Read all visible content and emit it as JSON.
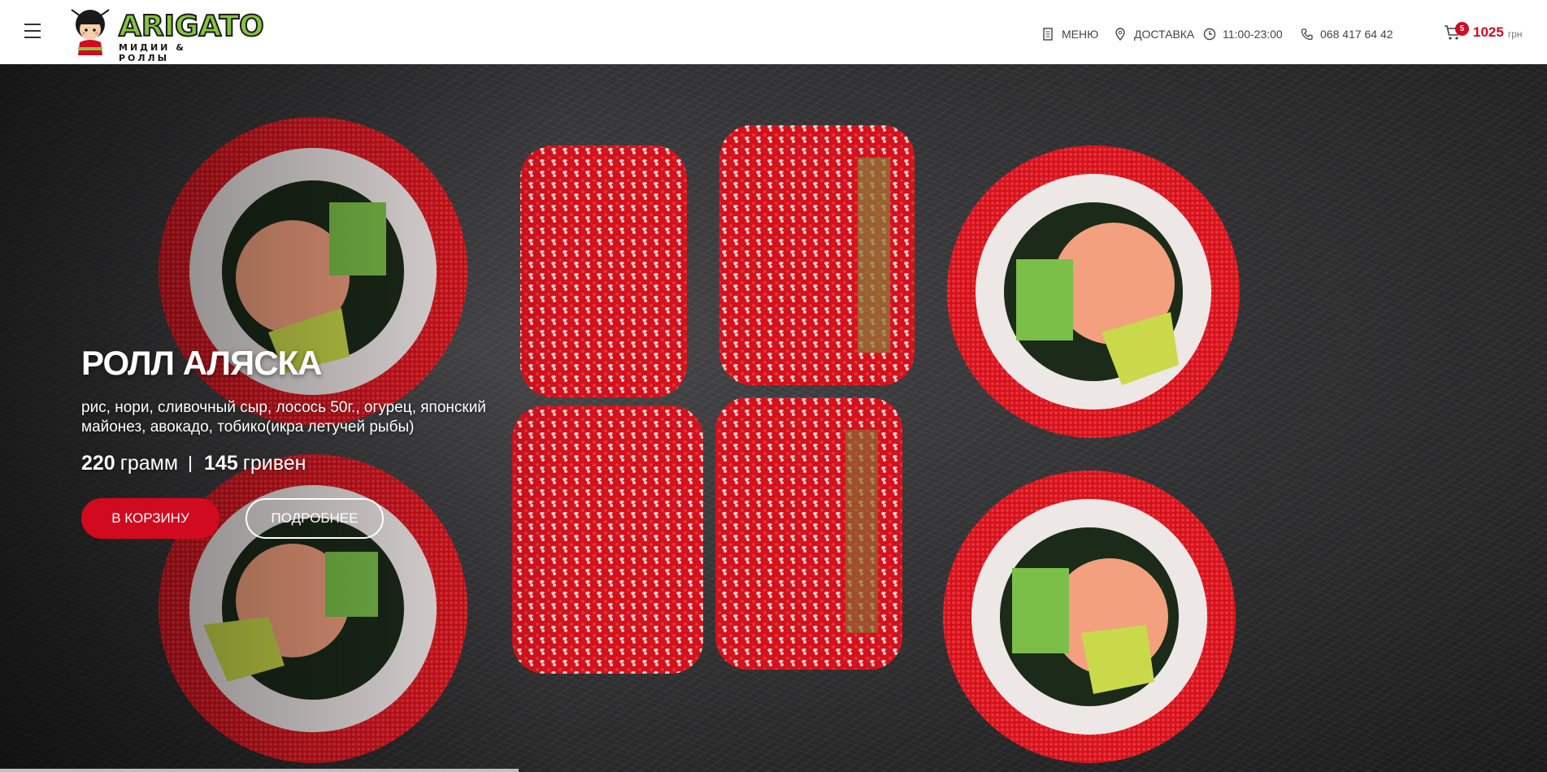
{
  "header": {
    "logo": {
      "name": "ARIGATO",
      "tagline": "МИДИИ & РОЛЛЫ"
    },
    "nav": {
      "menu": {
        "label": "МЕНЮ",
        "icon": "menu-card-icon"
      },
      "delivery": {
        "label": "ДОСТАВКА",
        "icon": "map-pin-icon"
      },
      "hours": {
        "label": "11:00-23:00",
        "icon": "clock-icon"
      },
      "phone": {
        "label": "068 417 64 42",
        "icon": "phone-icon"
      }
    },
    "cart": {
      "count": "5",
      "total": "1025",
      "currency": "грн",
      "icon": "cart-icon"
    }
  },
  "hero": {
    "title": "РОЛЛ АЛЯСКА",
    "description": "рис, нори, сливочный сыр, лосось 50г., огурец, японский майонез, авокадо, тобико(икра летучей рыбы)",
    "weight_value": "220",
    "weight_unit": "грамм",
    "price_value": "145",
    "price_unit": "гривен",
    "add_to_cart_label": "В КОРЗИНУ",
    "more_label": "ПОДРОБНЕЕ"
  },
  "colors": {
    "accent": "#d20a1f",
    "logo_green": "#86c53f",
    "header_bg": "#ffffff"
  }
}
